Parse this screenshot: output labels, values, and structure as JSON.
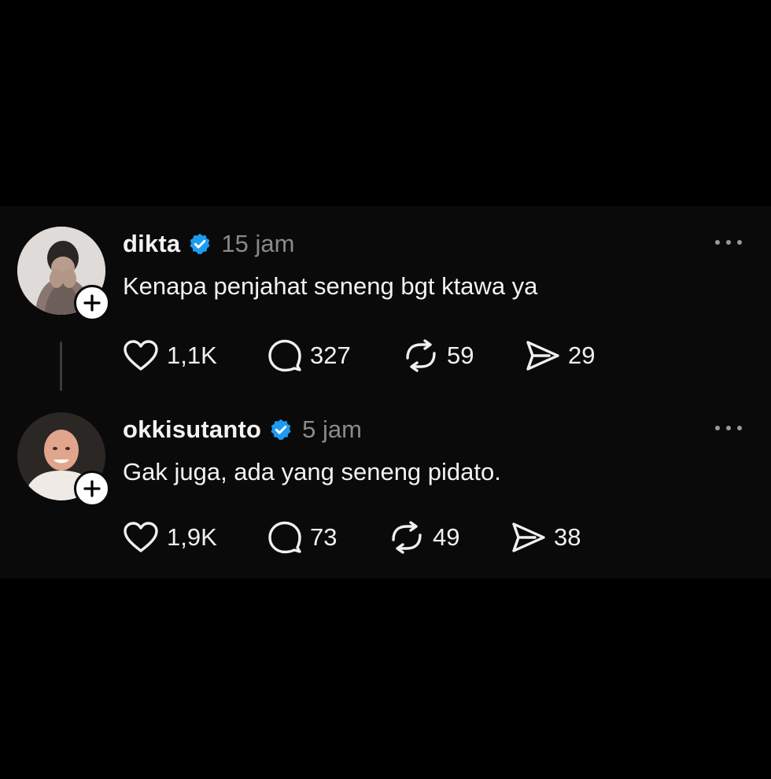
{
  "colors": {
    "background": "#000000",
    "panel": "#0a0a0a",
    "verified": "#1d9bf0",
    "text": "#f2f2f2",
    "muted": "#8a8a8a"
  },
  "posts": [
    {
      "username": "dikta",
      "verified": true,
      "time": "15 jam",
      "text": "Kenapa penjahat seneng bgt ktawa ya",
      "likes": "1,1K",
      "replies": "327",
      "reposts": "59",
      "shares": "29",
      "icons": [
        "heart-icon",
        "comment-icon",
        "repost-icon",
        "share-icon",
        "more-icon",
        "plus-icon",
        "verified-icon"
      ]
    },
    {
      "username": "okkisutanto",
      "verified": true,
      "time": "5 jam",
      "text": "Gak juga, ada yang seneng pidato.",
      "likes": "1,9K",
      "replies": "73",
      "reposts": "49",
      "shares": "38",
      "icons": [
        "heart-icon",
        "comment-icon",
        "repost-icon",
        "share-icon",
        "more-icon",
        "plus-icon",
        "verified-icon"
      ]
    }
  ]
}
